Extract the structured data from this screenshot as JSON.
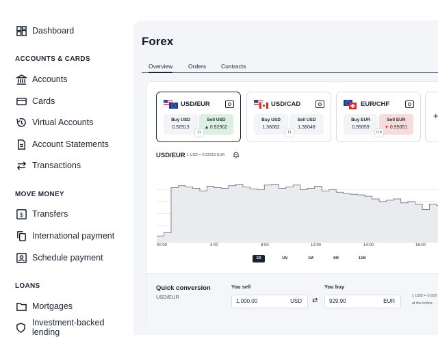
{
  "sidebar": {
    "dashboard": "Dashboard",
    "sections": {
      "accounts_cards": "ACCOUNTS & CARDS",
      "move_money": "MOVE MONEY",
      "loans": "LOANS"
    },
    "items": [
      {
        "label": "Accounts",
        "icon": "bank-icon"
      },
      {
        "label": "Cards",
        "icon": "card-icon"
      },
      {
        "label": "Virtual Accounts",
        "icon": "virtual-account-icon"
      },
      {
        "label": "Account Statements",
        "icon": "document-icon"
      },
      {
        "label": "Transactions",
        "icon": "swap-arrows-icon"
      },
      {
        "label": "Transfers",
        "icon": "dollar-icon"
      },
      {
        "label": "International payment",
        "icon": "copy-icon"
      },
      {
        "label": "Schedule payment",
        "icon": "calendar-user-icon"
      },
      {
        "label": "Mortgages",
        "icon": "folder-icon"
      },
      {
        "label": "Investment-backed lending",
        "icon": "shield-icon"
      }
    ]
  },
  "page": {
    "title": "Forex",
    "tabs": [
      "Overview",
      "Orders",
      "Contracts"
    ],
    "active_tab": "Overview"
  },
  "pairs": [
    {
      "code": "USD/EUR",
      "buy_label": "Buy USD",
      "buy": "0.92913",
      "sell_label": "Sell USD",
      "sell": "0.92902",
      "direction": "up",
      "spread": "11",
      "selected": true
    },
    {
      "code": "USD/CAD",
      "buy_label": "Buy USD",
      "buy": "1.36062",
      "sell_label": "Sell USD",
      "sell": "1.36048",
      "direction": "none",
      "spread": "11",
      "selected": false
    },
    {
      "code": "EUR/CHF",
      "buy_label": "Buy EUR",
      "buy": "0.95059",
      "sell_label": "Sell EUR",
      "sell": "0.95051",
      "direction": "down",
      "spread": "0.8",
      "selected": false
    }
  ],
  "add_pair": "+",
  "chart": {
    "title": "USD/EUR",
    "rate": "1 USD = 0.92913 EUR",
    "x_ticks": [
      "00:00",
      "4:00",
      "8:00",
      "12:00",
      "14:00",
      "16:00"
    ],
    "ranges": [
      "1D",
      "1W",
      "1M",
      "6M",
      "12M"
    ],
    "active_range": "1D"
  },
  "chart_data": {
    "type": "area",
    "title": "USD/EUR",
    "xlabel": "",
    "ylabel": "",
    "x": [
      "00:00",
      "4:00",
      "8:00",
      "12:00",
      "14:00",
      "16:00"
    ],
    "series": [
      {
        "values": [
          0.1,
          0.15,
          0.83,
          0.86,
          0.84,
          0.82,
          0.78,
          0.85,
          0.83,
          0.82,
          0.86,
          0.88,
          0.84,
          0.81,
          0.8,
          0.87,
          0.88,
          0.82,
          0.84,
          0.87,
          0.8,
          0.82,
          0.85,
          0.78,
          0.8,
          0.76,
          0.74,
          0.73,
          0.72,
          0.7,
          0.66,
          0.62,
          0.64,
          0.66,
          0.6,
          0.62,
          0.58,
          0.5,
          0.58,
          0.56,
          0.55,
          0.6
        ]
      }
    ],
    "grid": true,
    "legend": "none"
  },
  "quick": {
    "title": "Quick conversion",
    "pair": "USD/EUR",
    "sell_label": "You sell",
    "sell_value": "1,000.00",
    "sell_currency": "USD",
    "buy_label": "You buy",
    "buy_value": "929.90",
    "buy_currency": "EUR",
    "note_rate": "1 USD = 0.929",
    "note_text": "at the indica"
  }
}
